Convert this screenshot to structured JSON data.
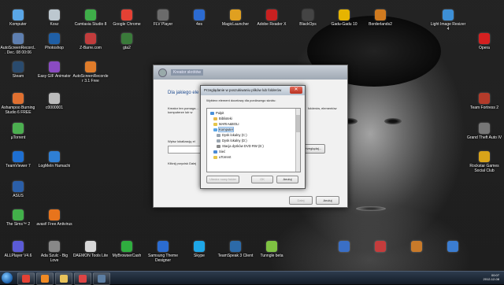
{
  "desktop": {
    "icons": [
      {
        "label": "Komputer",
        "icon": "computer-icon",
        "color": "#5aa6e6"
      },
      {
        "label": "Kosz",
        "icon": "trash-icon",
        "color": "#bcc7cf"
      },
      {
        "label": "Camtasia Studio 8",
        "icon": "camtasia-icon",
        "color": "#3fae49"
      },
      {
        "label": "Google Chrome",
        "icon": "chrome-icon",
        "color": "#e44134"
      },
      {
        "label": "FLV Player",
        "icon": "flv-player-icon",
        "color": "#6b6b6b"
      },
      {
        "label": "4es",
        "icon": "4es-icon",
        "color": "#2c6bd1"
      },
      {
        "label": "MagicLauncher",
        "icon": "magiclauncher-icon",
        "color": "#e0a020"
      },
      {
        "label": "Adobe Reader X",
        "icon": "adobe-reader-icon",
        "color": "#c82020"
      },
      {
        "label": "BlackOps",
        "icon": "blackops-icon",
        "color": "#444444"
      },
      {
        "label": "Gadu-Gadu 10",
        "icon": "gadu-gadu-icon",
        "color": "#e6b400"
      },
      {
        "label": "Borderlands2",
        "icon": "borderlands-icon",
        "color": "#d07a1f"
      },
      {
        "label": "Light Image Resizer 4",
        "icon": "image-resizer-icon",
        "color": "#3d8fd6"
      },
      {
        "label": "AutoScreenRecord... Dec. 08 00:06",
        "icon": "autoscreenrecorder-icon",
        "color": "#5e7fb0"
      },
      {
        "label": "Photoshop",
        "icon": "photoshop-icon",
        "color": "#1f5fa6"
      },
      {
        "label": "Z-Barre.com",
        "icon": "zbarre-icon",
        "color": "#c23c3c"
      },
      {
        "label": "gta2",
        "icon": "gta2-icon",
        "color": "#3a7a3a"
      },
      {
        "label": "Opera",
        "icon": "opera-icon",
        "color": "#d52020"
      },
      {
        "label": "Steam",
        "icon": "steam-icon",
        "color": "#2a4b6e"
      },
      {
        "label": "Easy GIF Animator",
        "icon": "gif-animator-icon",
        "color": "#8a4bc2"
      },
      {
        "label": "AutoScreenRecorder 3.1 Free",
        "icon": "autoscreenrecorder-free-icon",
        "color": "#e07c2a"
      },
      {
        "label": "Ashampoo Burning Studio 6 FREE",
        "icon": "ashampoo-icon",
        "color": "#e07030"
      },
      {
        "label": "c0000001",
        "icon": "file-icon",
        "color": "#bbbbbb"
      },
      {
        "label": "Team Fortress 2",
        "icon": "tf2-icon",
        "color": "#b33b2a"
      },
      {
        "label": "µTorrent",
        "icon": "utorrent-icon",
        "color": "#4caf50"
      },
      {
        "label": "Grand Theft Auto IV",
        "icon": "gta4-icon",
        "color": "#777777"
      },
      {
        "label": "TeamViewer 7",
        "icon": "teamviewer-icon",
        "color": "#1e6fd1"
      },
      {
        "label": "LogMeIn Hamachi",
        "icon": "hamachi-icon",
        "color": "#2f7fd4"
      },
      {
        "label": "Rockstar Games Social Club",
        "icon": "rockstar-icon",
        "color": "#d9a419"
      },
      {
        "label": "ASUS",
        "icon": "asus-icon",
        "color": "#2b5fa8"
      },
      {
        "label": "The Sims™ 2",
        "icon": "sims-icon",
        "color": "#42b04a"
      },
      {
        "label": "avast! Free Antivirus",
        "icon": "avast-icon",
        "color": "#e8741c"
      },
      {
        "label": "ALLPlayer V4.6",
        "icon": "allplayer-icon",
        "color": "#5b5bd6"
      },
      {
        "label": "Ada Szulc - Big Love",
        "icon": "video-file-icon",
        "color": "#888888"
      },
      {
        "label": "DAEMON Tools Lite",
        "icon": "daemon-tools-icon",
        "color": "#d8d8d8"
      },
      {
        "label": "MyBrowserCash",
        "icon": "mybrowsercash-icon",
        "color": "#2fae3f"
      },
      {
        "label": "Samsung Theme Designer",
        "icon": "samsung-icon",
        "color": "#2b6cd1"
      },
      {
        "label": "Skype",
        "icon": "skype-icon",
        "color": "#1ea7e8"
      },
      {
        "label": "TeamSpeak 3 Client",
        "icon": "teamspeak-icon",
        "color": "#2c6aa8"
      },
      {
        "label": "Tunngle beta",
        "icon": "tunngle-icon",
        "color": "#7fc242"
      },
      {
        "label": "",
        "icon": "game-icon-1",
        "color": "#3a6fc6"
      },
      {
        "label": "",
        "icon": "game-icon-2",
        "color": "#c43c3c"
      },
      {
        "label": "",
        "icon": "game-icon-3",
        "color": "#c87a2a"
      },
      {
        "label": "",
        "icon": "game-icon-4",
        "color": "#3b7dd1"
      }
    ]
  },
  "wizard": {
    "title_caption": "Kreator skrótów",
    "heading": "Dla jakiego ele",
    "description": "Kreator ten pomaga... komputerze lub w",
    "description_right": "folderów, elementów",
    "location_label": "Wpisz lokalizację el",
    "browse_label": "Przeglądaj...",
    "shortcut_label": "Kliknij przycisk Dalej",
    "next_label": "Dalej",
    "cancel_label": "Anuluj"
  },
  "browse_dialog": {
    "title": "Przeglądanie w poszukiwaniu plików lub folderów",
    "instruction": "Wybierz element docelowy dla poniższego skrótu:",
    "tree": [
      {
        "label": "Pulpit",
        "icon": "desktop-folder-icon",
        "color": "#4a90d9"
      },
      {
        "label": "Biblioteki",
        "icon": "libraries-icon",
        "color": "#e6b84a"
      },
      {
        "label": "MARIA&BOLI",
        "icon": "user-folder-icon",
        "color": "#e6c64a"
      },
      {
        "label": "Komputer",
        "icon": "computer-icon",
        "color": "#5aa6e6"
      },
      {
        "label": "Dysk lokalny (C:)",
        "icon": "drive-icon",
        "color": "#9aa5b0"
      },
      {
        "label": "Dysk lokalny (D:)",
        "icon": "drive-icon",
        "color": "#9aa5b0"
      },
      {
        "label": "Stacja dysków DVD RW (E:)",
        "icon": "dvd-drive-icon",
        "color": "#8a8a8a"
      },
      {
        "label": "Sieć",
        "icon": "network-icon",
        "color": "#4a8ad6"
      },
      {
        "label": "uTorrent",
        "icon": "folder-icon",
        "color": "#e6c64a"
      }
    ],
    "new_folder_label": "Utwórz nowy folder",
    "ok_label": "OK",
    "cancel_label": "Anuluj"
  },
  "taskbar": {
    "items": [
      {
        "icon": "chrome-taskbar-icon",
        "color": "#e44134"
      },
      {
        "icon": "media-player-taskbar-icon",
        "color": "#f08a24"
      },
      {
        "icon": "explorer-taskbar-icon",
        "color": "#e8c25a"
      },
      {
        "icon": "app-taskbar-icon",
        "color": "#d44"
      },
      {
        "icon": "steam-taskbar-icon",
        "color": "#5c7ea3"
      }
    ],
    "clock_time": "00:07",
    "clock_date": "2012-12-08"
  }
}
